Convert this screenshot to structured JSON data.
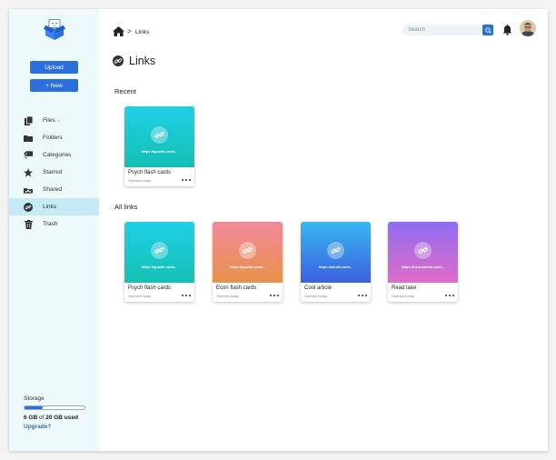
{
  "sidebar": {
    "upload_label": "Upload",
    "new_label": "+ New",
    "nav": [
      {
        "label": "Files",
        "icon": "files-icon",
        "suffix": "⌵"
      },
      {
        "label": "Folders",
        "icon": "folder-icon"
      },
      {
        "label": "Categories",
        "icon": "tag-icon"
      },
      {
        "label": "Starred",
        "icon": "star-icon"
      },
      {
        "label": "Shared",
        "icon": "shared-icon"
      },
      {
        "label": "Links",
        "icon": "link-icon",
        "active": true
      },
      {
        "label": "Trash",
        "icon": "trash-icon"
      }
    ],
    "storage": {
      "label": "Storage",
      "used": "6 GB",
      "of_text": "of",
      "total": "20 GB used",
      "fraction": 0.3,
      "upgrade_label": "Upgrade?"
    }
  },
  "header": {
    "breadcrumb_sep": ">",
    "breadcrumb": "Links",
    "search_placeholder": "Search"
  },
  "page": {
    "title": "Links",
    "recent_label": "Recent",
    "all_label": "All links"
  },
  "recent": [
    {
      "url": "https://quizlet.com/...",
      "name": "Psych flash cards",
      "opened": "Opened today",
      "gradient": [
        "#1fd0e6",
        "#14c0b3"
      ]
    }
  ],
  "all_links": [
    {
      "url": "https://quizlet.com/...",
      "name": "Psych flash cards",
      "opened": "Opened today",
      "gradient": [
        "#1fd0e6",
        "#14c0b3"
      ]
    },
    {
      "url": "https://quizlet.com/...",
      "name": "Econ flash cards",
      "opened": "Opened today",
      "gradient": [
        "#f0899a",
        "#e8924a"
      ]
    },
    {
      "url": "https://wired.com/...",
      "name": "Cool article",
      "opened": "Opened today",
      "gradient": [
        "#37b8f0",
        "#3b5fe0"
      ]
    },
    {
      "url": "https://economist.com/...",
      "name": "Read later",
      "opened": "Opened today",
      "gradient": [
        "#8f6cf0",
        "#e06cc9"
      ]
    }
  ],
  "colors": {
    "accent": "#2a6fdb",
    "sidebar_bg": "#eef9fb",
    "active_bg": "#c6eaf6"
  }
}
